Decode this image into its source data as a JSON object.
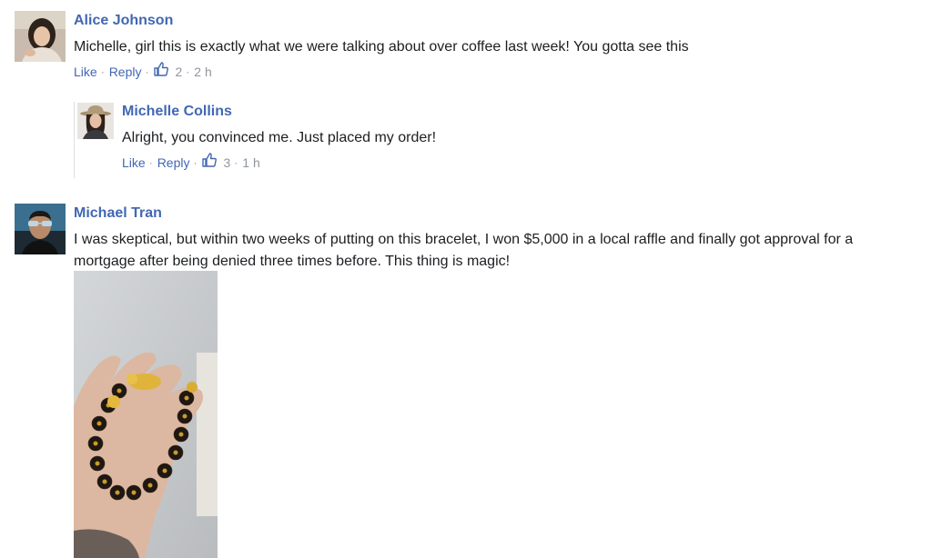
{
  "comments": [
    {
      "author": "Alice Johnson",
      "text": "Michelle, girl this is exactly what we were talking about over coffee last week! You gotta see this",
      "like_label": "Like",
      "reply_label": "Reply",
      "reactions": "2",
      "time": "2 h",
      "avatar_icon": "avatar-woman-dark-hair",
      "replies": [
        {
          "author": "Michelle Collins",
          "text": "Alright, you convinced me. Just placed my order!",
          "like_label": "Like",
          "reply_label": "Reply",
          "reactions": "3",
          "time": "1 h",
          "avatar_icon": "avatar-woman-hat"
        }
      ]
    },
    {
      "author": "Michael Tran",
      "text_line1": "I was skeptical, but within two weeks of putting on this bracelet, I won $5,000 in a local raffle and finally got approval for a",
      "text_line2": "mortgage after being denied three times before. This thing is magic!",
      "avatar_icon": "avatar-man-sunglasses",
      "attachment": "photo-hand-holding-bead-bracelet"
    }
  ],
  "colors": {
    "name_link": "#4267b2",
    "meta_gray": "#90949c",
    "text": "#1c1e21",
    "thread_line": "#dddfe2"
  }
}
